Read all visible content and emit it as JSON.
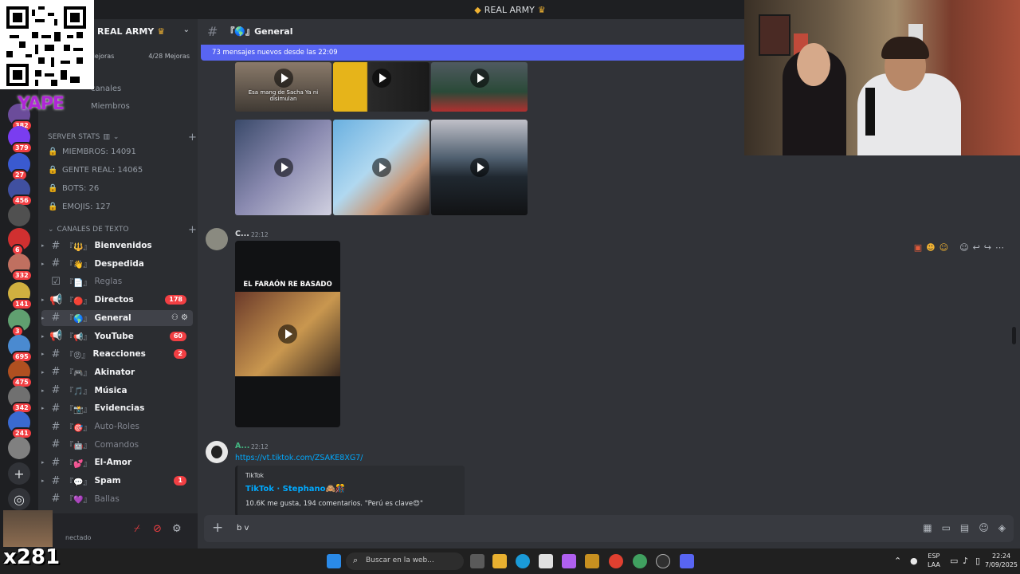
{
  "window": {
    "title": "REAL ARMY"
  },
  "qr": {
    "brand": "YAPE"
  },
  "servers": [
    {
      "badge": "382",
      "color": "#6b4c9a"
    },
    {
      "badge": "379",
      "color": "#7a3df0"
    },
    {
      "badge": "27",
      "color": "#3a5ad0"
    },
    {
      "badge": "456",
      "color": "#4050a0"
    },
    {
      "badge": "",
      "color": "#505050"
    },
    {
      "badge": "6",
      "color": "#d03030"
    },
    {
      "badge": "332",
      "color": "#c07060"
    },
    {
      "badge": "141",
      "color": "#d0b040"
    },
    {
      "badge": "3",
      "color": "#60a070"
    },
    {
      "badge": "695",
      "color": "#4a8ad0"
    },
    {
      "badge": "475",
      "color": "#b05020"
    },
    {
      "badge": "342",
      "color": "#707070"
    },
    {
      "badge": "241",
      "color": "#3a6ad0"
    },
    {
      "badge": "",
      "color": "#808080"
    }
  ],
  "sidebar": {
    "server_name": "REAL ARMY",
    "boost": {
      "left": "Mejoras",
      "right": "4/28 Mejoras"
    },
    "browse_channels": "canales",
    "members_link": "Miembros",
    "stats_category": "SERVER STATS",
    "stats": [
      {
        "label": "MIEMBROS: 14091"
      },
      {
        "label": "GENTE REAL: 14065"
      },
      {
        "label": "BOTS: 26"
      },
      {
        "label": "EMOJIS: 127"
      }
    ],
    "text_category": "CANALES DE TEXTO",
    "channels": [
      {
        "name": "Bienvenidos",
        "emoji": "『🔱』",
        "icon": "#",
        "count": "",
        "muted": false,
        "active": false
      },
      {
        "name": "Despedida",
        "emoji": "『👋』",
        "icon": "#",
        "count": "",
        "muted": false,
        "active": false
      },
      {
        "name": "Reglas",
        "emoji": "『📄』",
        "icon": "☑",
        "count": "",
        "muted": true,
        "active": false
      },
      {
        "name": "Directos",
        "emoji": "『🔴』",
        "icon": "📢",
        "count": "178",
        "muted": false,
        "active": false
      },
      {
        "name": "General",
        "emoji": "『🌎』",
        "icon": "#",
        "count": "",
        "muted": false,
        "active": true
      },
      {
        "name": "YouTube",
        "emoji": "『📢』",
        "icon": "📢",
        "count": "60",
        "muted": false,
        "active": false
      },
      {
        "name": "Reacciones",
        "emoji": "『😡』",
        "icon": "#",
        "count": "2",
        "muted": false,
        "active": false
      },
      {
        "name": "Akinator",
        "emoji": "『🎮』",
        "icon": "#",
        "count": "",
        "muted": false,
        "active": false
      },
      {
        "name": "Música",
        "emoji": "『🎵』",
        "icon": "#",
        "count": "",
        "muted": false,
        "active": false
      },
      {
        "name": "Evidencias",
        "emoji": "『📸』",
        "icon": "#",
        "count": "",
        "muted": false,
        "active": false
      },
      {
        "name": "Auto-Roles",
        "emoji": "『🎯』",
        "icon": "#",
        "count": "",
        "muted": true,
        "active": false
      },
      {
        "name": "Comandos",
        "emoji": "『🤖』",
        "icon": "#",
        "count": "",
        "muted": true,
        "active": false
      },
      {
        "name": "El-Amor",
        "emoji": "『💕』",
        "icon": "#",
        "count": "",
        "muted": false,
        "active": false
      },
      {
        "name": "Spam",
        "emoji": "『💬』",
        "icon": "#",
        "count": "1",
        "muted": false,
        "active": false
      },
      {
        "name": "Ballas",
        "emoji": "『💜』",
        "icon": "#",
        "count": "",
        "muted": true,
        "active": false
      }
    ]
  },
  "user_panel": {
    "status": "nectado",
    "streamer_badge": "x281"
  },
  "chat": {
    "channel_title": "『🌎』General",
    "new_messages": "73 mensajes nuevos desde las 22:09",
    "grid_captions": [
      "Esa mang de Sacha\nYa ni disimulan",
      "",
      "",
      "",
      "",
      ""
    ],
    "msg1": {
      "author": "C...",
      "time": "22:12",
      "video_title": "EL FARAÓN RE BASADO"
    },
    "msg2": {
      "author": "A...",
      "time": "22:12",
      "link": "https://vt.tiktok.com/ZSAKE8XG7/",
      "embed_provider": "TikTok",
      "embed_title": "TikTok · Stephano🙈🎊",
      "embed_desc": "10.6K me gusta, 194 comentarios. \"Perú es clave😍\""
    },
    "composer_text": "b v"
  },
  "taskbar": {
    "search_placeholder": "Buscar en la web...",
    "lang_top": "ESP",
    "lang_bottom": "LAA",
    "time": "22:24",
    "date": "7/09/2025"
  }
}
